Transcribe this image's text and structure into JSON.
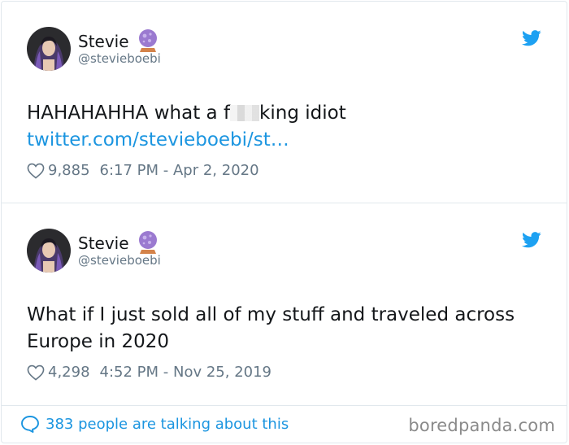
{
  "tweets": [
    {
      "name": "Stevie",
      "handle": "@stevieboebi",
      "text_before": "HAHAHAHHA what a f",
      "text_after": "king idiot",
      "link": "twitter.com/stevieboebi/st…",
      "likes": "9,885",
      "timestamp": "6:17 PM - Apr 2, 2020"
    },
    {
      "name": "Stevie",
      "handle": "@stevieboebi",
      "text": "What if I just sold all of my stuff and traveled across Europe in 2020",
      "likes": "4,298",
      "timestamp": "4:52 PM - Nov 25, 2019"
    }
  ],
  "footer": {
    "talking": "383 people are talking about this",
    "watermark": "boredpanda.com"
  },
  "colors": {
    "link": "#1b95e0",
    "muted": "#657786",
    "border": "#e1e8ed"
  },
  "icons": [
    "crystal-ball-icon",
    "twitter-bird-icon",
    "heart-icon",
    "speech-bubble-icon"
  ]
}
